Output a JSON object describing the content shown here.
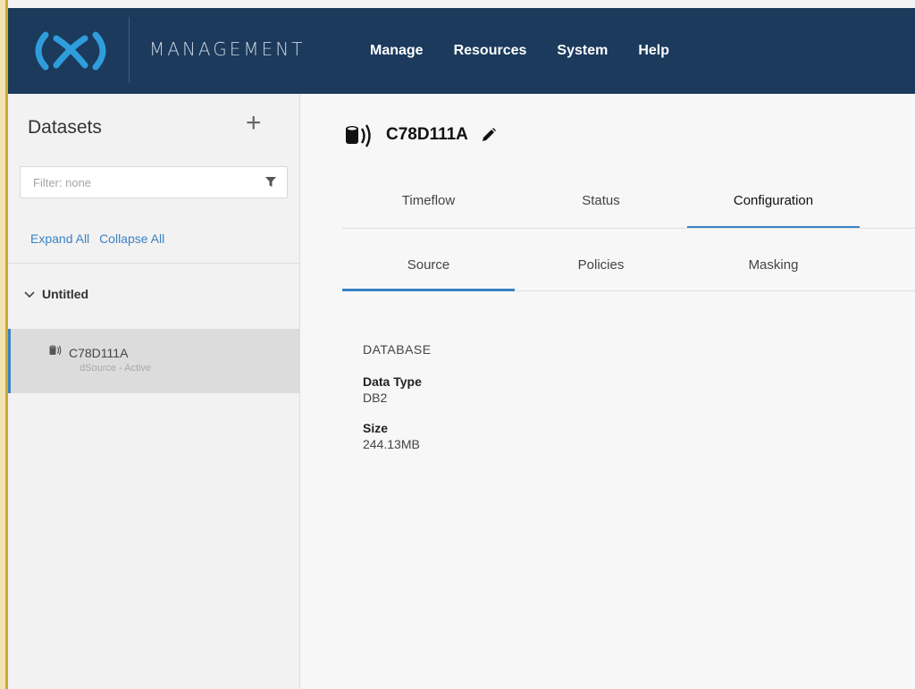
{
  "header": {
    "app_name": "MANAGEMENT",
    "nav": [
      "Manage",
      "Resources",
      "System",
      "Help"
    ],
    "brand_color": "#1b3a5c",
    "logo_color": "#2f9ddc"
  },
  "sidebar": {
    "title": "Datasets",
    "add_icon": "plus-icon",
    "filter_placeholder": "Filter: none",
    "filter_icon": "filter-icon",
    "expand_all": "Expand All",
    "collapse_all": "Collapse All",
    "group": {
      "name": "Untitled",
      "icon": "chevron-down-icon"
    },
    "dataset": {
      "name": "C78D111A",
      "subtitle": "dSource - Active",
      "icon": "database-icon"
    }
  },
  "main": {
    "title": "C78D111A",
    "title_icon": "database-icon",
    "edit_icon": "pencil-icon",
    "tabs": [
      {
        "label": "Timeflow",
        "active": false
      },
      {
        "label": "Status",
        "active": false
      },
      {
        "label": "Configuration",
        "active": true
      }
    ],
    "subtabs": [
      {
        "label": "Source",
        "active": true
      },
      {
        "label": "Policies",
        "active": false
      },
      {
        "label": "Masking",
        "active": false
      }
    ],
    "section": "DATABASE",
    "fields": [
      {
        "label": "Data Type",
        "value": "DB2"
      },
      {
        "label": "Size",
        "value": "244.13MB"
      }
    ],
    "accent_color": "#3a82c4"
  }
}
